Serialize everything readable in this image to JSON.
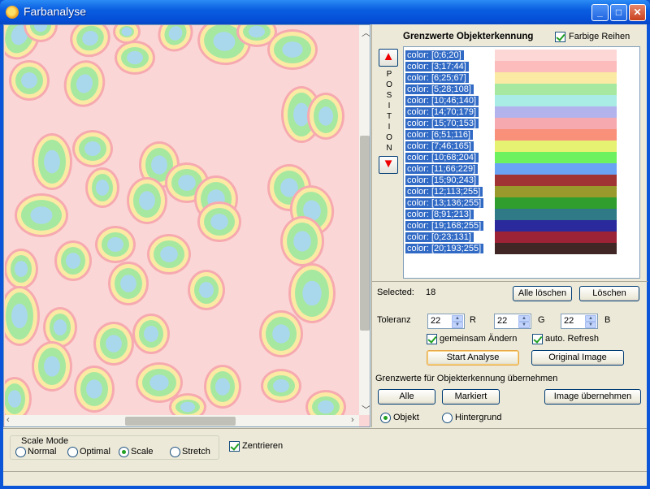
{
  "window": {
    "title": "Farbanalyse",
    "min": "_",
    "max": "□",
    "close": "✕"
  },
  "panel": {
    "header": "Grenzwerte Objekterkennung",
    "colored_rows_label": "Farbige Reihen",
    "colored_rows_checked": true,
    "position_letters": [
      "P",
      "O",
      "S",
      "I",
      "T",
      "I",
      "O",
      "N"
    ],
    "rows": [
      {
        "label": "color:  [0;6;20]",
        "color": "#fdd6d6"
      },
      {
        "label": "color:  [3;17;44]",
        "color": "#fcbcbc"
      },
      {
        "label": "color:  [6;25;67]",
        "color": "#fbeaa3"
      },
      {
        "label": "color:  [5;28;108]",
        "color": "#a6e8a0"
      },
      {
        "label": "color:  [10;46;140]",
        "color": "#a9ece6"
      },
      {
        "label": "color:  [14;70;179]",
        "color": "#b2b2ec"
      },
      {
        "label": "color:  [15;70;153]",
        "color": "#f6aab0"
      },
      {
        "label": "color:  [6;51;116]",
        "color": "#f8907a"
      },
      {
        "label": "color:  [7;46;165]",
        "color": "#e6f271"
      },
      {
        "label": "color:  [10;68;204]",
        "color": "#6ef15f"
      },
      {
        "label": "color:  [11;66;229]",
        "color": "#6aa2f4"
      },
      {
        "label": "color:  [15;90;243]",
        "color": "#a03434"
      },
      {
        "label": "color:  [12;113;255]",
        "color": "#9a9a2c"
      },
      {
        "label": "color:  [13;136;255]",
        "color": "#2f9e2f"
      },
      {
        "label": "color:  [8;91;213]",
        "color": "#2f7a86"
      },
      {
        "label": "color:  [19;168;255]",
        "color": "#2a2a9c"
      },
      {
        "label": "color:  [0;23;131]",
        "color": "#9c2236"
      },
      {
        "label": "color:  [20;193;255]",
        "color": "#412626"
      }
    ],
    "selected_label": "Selected:",
    "selected_value": "18",
    "btn_clear_all": "Alle löschen",
    "btn_delete": "Löschen",
    "tolerance_label": "Toleranz",
    "tol_r": "22",
    "tol_r_label": "R",
    "tol_g": "22",
    "tol_g_label": "G",
    "tol_b": "22",
    "tol_b_label": "B",
    "change_together_label": "gemeinsam Ändern",
    "change_together_checked": true,
    "auto_refresh_label": "auto. Refresh",
    "auto_refresh_checked": true,
    "btn_start": "Start Analyse",
    "btn_original": "Original Image",
    "take_over_label": "Grenzwerte für Objekterkennung übernehmen",
    "btn_all": "Alle",
    "btn_marked": "Markiert",
    "btn_take_image": "Image übernehmen",
    "radio_object": "Objekt",
    "radio_background": "Hintergrund",
    "radio_selected": "Objekt"
  },
  "scale": {
    "title": "Scale Mode",
    "options": [
      "Normal",
      "Optimal",
      "Scale",
      "Stretch"
    ],
    "selected": "Scale",
    "center_label": "Zentrieren",
    "center_checked": true
  },
  "colors": {
    "background": "#fbd6d6",
    "cell_ring": "#fbeaa3",
    "cell_body": "#a6e8a0",
    "cell_core": "#a9d8ec",
    "selection": "#316ac5"
  }
}
